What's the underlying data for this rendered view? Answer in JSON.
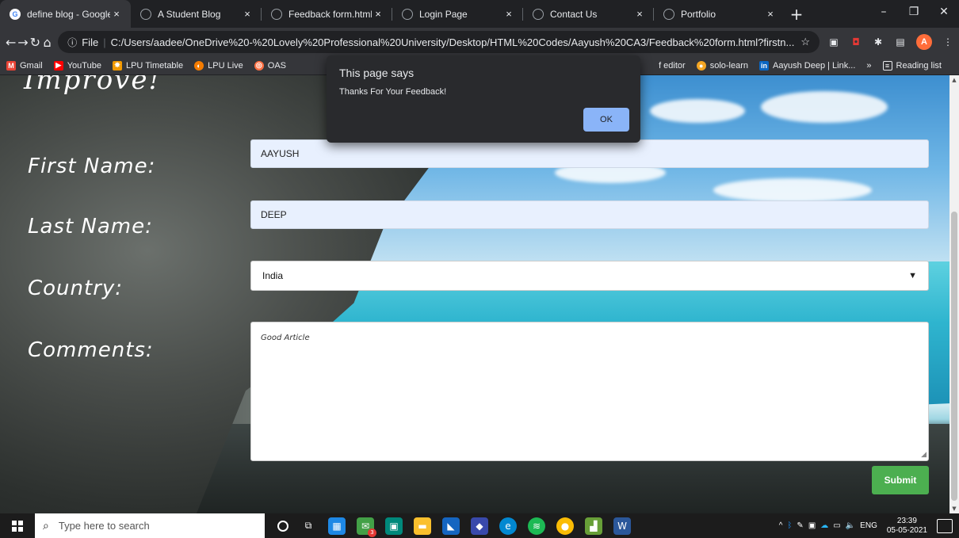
{
  "tabs": [
    {
      "label": "define blog - Google S",
      "icon": "google-icon",
      "active": true
    },
    {
      "label": "A Student Blog",
      "icon": "globe-icon"
    },
    {
      "label": "Feedback form.html?f",
      "icon": "globe-icon"
    },
    {
      "label": "Login Page",
      "icon": "globe-icon"
    },
    {
      "label": "Contact Us",
      "icon": "globe-icon"
    },
    {
      "label": "Portfolio",
      "icon": "globe-icon"
    }
  ],
  "address_bar": {
    "scheme_label": "File",
    "url": "C:/Users/aadee/OneDrive%20-%20Lovely%20Professional%20University/Desktop/HTML%20Codes/Aayush%20CA3/Feedback%20form.html?firstn..."
  },
  "profile_initial": "A",
  "bookmarks": [
    {
      "label": "Gmail",
      "color": "#ea4335"
    },
    {
      "label": "YouTube",
      "color": "#ff0000"
    },
    {
      "label": "LPU Timetable",
      "color": "#f29900"
    },
    {
      "label": "LPU Live",
      "color": "#f57c00"
    },
    {
      "label": "OAS",
      "color": "#ff7043"
    }
  ],
  "bookmarks_right": [
    {
      "label": "f editor"
    },
    {
      "label": "solo-learn"
    },
    {
      "label": "Aayush Deep | Link..."
    }
  ],
  "reading_list": "Reading list",
  "page": {
    "heading_fragment": "Improve!",
    "labels": {
      "first_name": "First Name:",
      "last_name": "Last Name:",
      "country": "Country:",
      "comments": "Comments:"
    },
    "values": {
      "first_name": "AAYUSH",
      "last_name": "DEEP",
      "country": "India",
      "comments": "Good Article"
    },
    "submit_label": "Submit"
  },
  "dialog": {
    "title": "This page says",
    "message": "Thanks For Your Feedback!",
    "ok_label": "OK"
  },
  "taskbar": {
    "search_placeholder": "Type here to search",
    "mail_badge": "3",
    "language": "ENG",
    "time": "23:39",
    "date": "05-05-2021"
  },
  "colors": {
    "submit": "#4caf50",
    "ok_button": "#8ab4f8",
    "autofill_bg": "#e8f0fe"
  }
}
